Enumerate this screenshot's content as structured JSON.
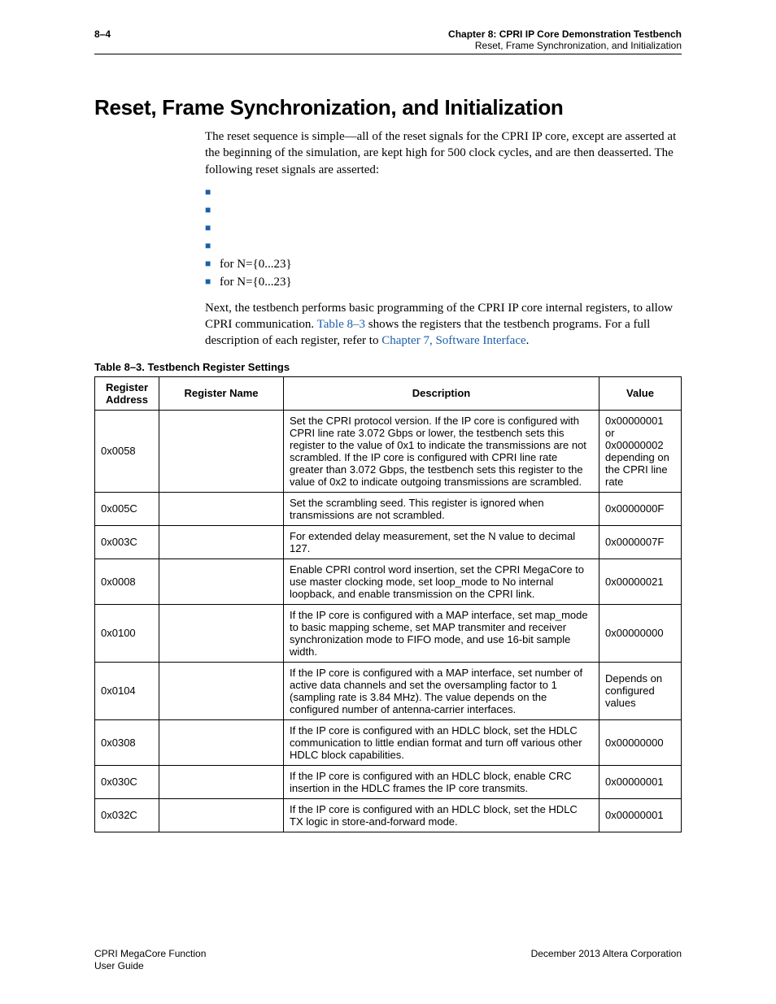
{
  "header": {
    "page_num": "8–4",
    "chapter_line": "Chapter 8: CPRI IP Core Demonstration Testbench",
    "section_line": "Reset, Frame Synchronization, and Initialization"
  },
  "section_title": "Reset, Frame Synchronization, and Initialization",
  "intro_para": "The reset sequence is simple—all of the reset signals for the CPRI IP core, except              are asserted at the beginning of the simulation, are kept high for 500 clock cycles, and are then deasserted. The following reset signals are asserted:",
  "signals": [
    "",
    "",
    "",
    "",
    "                                  for N={0...23}",
    "                                  for N={0...23}"
  ],
  "para2_pre": "Next, the testbench performs basic programming of the CPRI IP core internal registers, to allow CPRI communication. ",
  "para2_link1": "Table 8–3",
  "para2_mid": " shows the registers that the testbench programs. For a full description of each register, refer to ",
  "para2_link2": "Chapter 7, Software Interface",
  "para2_post": ".",
  "table_caption": "Table 8–3. Testbench Register Settings",
  "table": {
    "headers": {
      "addr": "Register Address",
      "name": "Register Name",
      "desc": "Description",
      "val": "Value"
    },
    "rows": [
      {
        "addr": "0x0058",
        "name": "",
        "desc": "Set the CPRI protocol version. If the IP core is configured with CPRI line rate 3.072 Gbps or lower, the testbench sets this register to the value of 0x1 to indicate the transmissions are not scrambled. If the IP core is configured with CPRI line rate greater than 3.072 Gbps, the testbench sets this register to the value of 0x2 to indicate outgoing transmissions are scrambled.",
        "val": "0x00000001 or 0x00000002 depending on the CPRI line rate"
      },
      {
        "addr": "0x005C",
        "name": "",
        "desc": "Set the scrambling seed. This register is ignored when transmissions are not scrambled.",
        "val": "0x0000000F"
      },
      {
        "addr": "0x003C",
        "name": "",
        "desc": "For extended delay measurement, set the N value to decimal 127.",
        "val": "0x0000007F"
      },
      {
        "addr": "0x0008",
        "name": "",
        "desc": "Enable CPRI control word insertion, set the CPRI MegaCore to use master clocking mode, set loop_mode to No internal loopback, and enable transmission on the CPRI link.",
        "val": "0x00000021"
      },
      {
        "addr": "0x0100",
        "name": "",
        "desc": "If the IP core is configured with a MAP interface, set map_mode to basic mapping scheme, set MAP transmiter and receiver synchronization mode to FIFO mode, and use 16-bit sample width.",
        "val": "0x00000000"
      },
      {
        "addr": "0x0104",
        "name": "",
        "desc": "If the IP core is configured with a MAP interface, set number of active data channels and set the oversampling factor to 1 (sampling rate is 3.84 MHz). The value depends on the configured number of antenna-carrier interfaces.",
        "val": "Depends on configured values"
      },
      {
        "addr": "0x0308",
        "name": "",
        "desc": "If the IP core is configured with an HDLC block, set the HDLC communication to little endian format and turn off various other HDLC block capabilities.",
        "val": "0x00000000"
      },
      {
        "addr": "0x030C",
        "name": "",
        "desc": "If the IP core is configured with an HDLC block, enable CRC insertion in the HDLC frames the IP core transmits.",
        "val": "0x00000001"
      },
      {
        "addr": "0x032C",
        "name": "",
        "desc": "If the IP core is configured with an HDLC block, set the HDLC TX logic in store-and-forward mode.",
        "val": "0x00000001"
      }
    ]
  },
  "footer": {
    "left_line1": "CPRI MegaCore Function",
    "left_line2": "User Guide",
    "right": "December 2013   Altera Corporation"
  }
}
